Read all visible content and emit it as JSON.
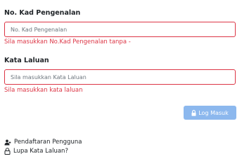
{
  "ic_field": {
    "label": "No. Kad Pengenalan",
    "placeholder": "No. Kad Pengenalan",
    "value": "",
    "error": "Sila masukkan No.Kad Pengenalan tanpa -"
  },
  "password_field": {
    "label": "Kata Laluan",
    "placeholder": "Sila masukkan Kata Laluan",
    "value": "",
    "error": "Sila masukkan kata laluan"
  },
  "login_button": {
    "label": "Log Masuk",
    "icon": "lock-icon"
  },
  "links": {
    "register": {
      "label": "Pendaftaran Pengguna",
      "icon": "user-plus-icon"
    },
    "forgot_password": {
      "label": "Lupa Kata Laluan?",
      "icon": "lock-outline-icon"
    }
  },
  "colors": {
    "error": "#dc3545",
    "button_bg": "#8cb8ee",
    "text": "#212529"
  }
}
